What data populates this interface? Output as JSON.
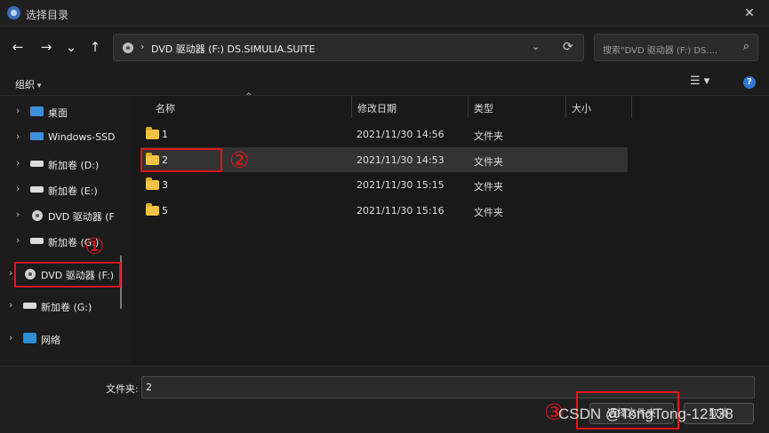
{
  "window": {
    "title": "选择目录",
    "close_glyph": "✕"
  },
  "nav": {
    "back_glyph": "←",
    "forward_glyph": "→",
    "recent_glyph": "⌄",
    "up_glyph": "↑",
    "address_sep": "›",
    "address_path": "DVD 驱动器 (F:) DS.SIMULIA.SUITE",
    "address_dropdown_glyph": "⌄",
    "refresh_glyph": "⟳",
    "search_placeholder": "搜索\"DVD 驱动器 (F:) DS....",
    "search_glyph": "⌕"
  },
  "toolbar": {
    "organize": "组织",
    "view_glyph": "☰ ▾",
    "help_glyph": "?"
  },
  "sidebar": {
    "items": [
      {
        "label": "桌面",
        "chev": "›",
        "icon": "desktop-icon"
      },
      {
        "label": "Windows-SSD",
        "chev": "›",
        "icon": "ssd-icon"
      },
      {
        "label": "新加卷 (D:)",
        "chev": "›",
        "icon": "drive-icon"
      },
      {
        "label": "新加卷 (E:)",
        "chev": "›",
        "icon": "drive-icon"
      },
      {
        "label": "DVD 驱动器 (F",
        "chev": "›",
        "icon": "dvd-icon"
      },
      {
        "label": "新加卷 (G:)",
        "chev": "›",
        "icon": "drive-icon"
      },
      {
        "label": "DVD 驱动器 (F:)",
        "chev": "›",
        "icon": "dvd-icon"
      },
      {
        "label": "新加卷 (G:)",
        "chev": "›",
        "icon": "drive-icon"
      },
      {
        "label": "网络",
        "chev": "›",
        "icon": "network-icon"
      }
    ]
  },
  "columns": {
    "name": "名称",
    "date": "修改日期",
    "type": "类型",
    "size": "大小",
    "sort_glyph": "^"
  },
  "files": [
    {
      "name": "1",
      "date": "2021/11/30 14:56",
      "type": "文件夹"
    },
    {
      "name": "2",
      "date": "2021/11/30 14:53",
      "type": "文件夹"
    },
    {
      "name": "3",
      "date": "2021/11/30 15:15",
      "type": "文件夹"
    },
    {
      "name": "5",
      "date": "2021/11/30 15:16",
      "type": "文件夹"
    }
  ],
  "footer": {
    "folder_label": "文件夹:",
    "folder_value": "2",
    "select_button": "选择文件夹",
    "cancel_button": "取消"
  },
  "annotations": {
    "step1": "①",
    "step2": "②",
    "step3": "③"
  },
  "watermark": "CSDN @TongTong-12138",
  "colors": {
    "annotation_red": "#e0161d",
    "folder_yellow": "#f3c443",
    "accent_blue": "#2f77d0"
  }
}
